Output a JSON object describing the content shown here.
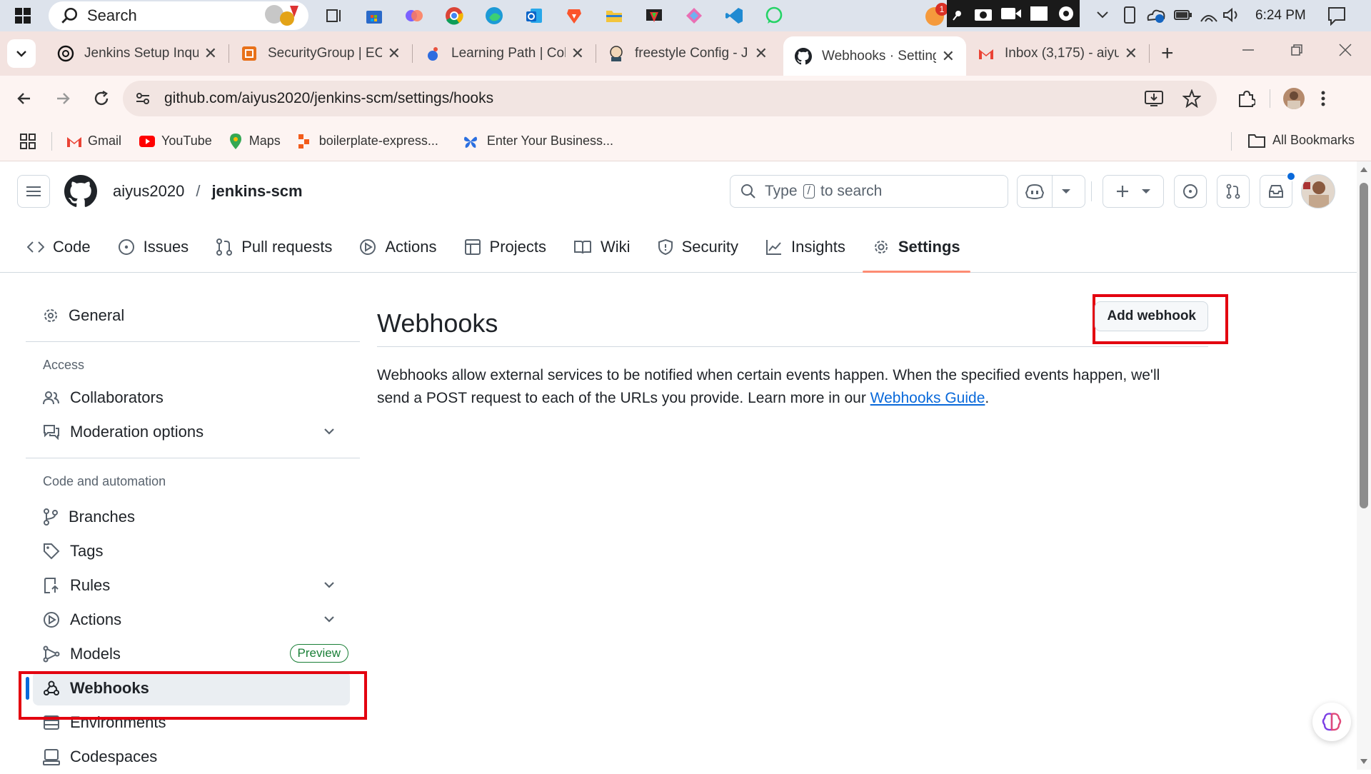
{
  "taskbar": {
    "search_placeholder": "Search",
    "time": "6:24 PM",
    "notification_count": "1"
  },
  "tabs": [
    {
      "label": "Jenkins Setup Inqu",
      "icon": "openai-icon"
    },
    {
      "label": "SecurityGroup | EC",
      "icon": "aws-icon"
    },
    {
      "label": "Learning Path | Col",
      "icon": "learning-icon"
    },
    {
      "label": "freestyle Config - J",
      "icon": "jenkins-icon"
    },
    {
      "label": "Webhooks · Setting",
      "icon": "github-icon",
      "active": true
    },
    {
      "label": "Inbox (3,175) - aiyu",
      "icon": "gmail-icon"
    }
  ],
  "address": {
    "url": "github.com/aiyus2020/jenkins-scm/settings/hooks"
  },
  "bookmarks": {
    "items": [
      "Gmail",
      "YouTube",
      "Maps",
      "boilerplate-express...",
      "Enter Your Business..."
    ],
    "all": "All Bookmarks"
  },
  "header": {
    "owner": "aiyus2020",
    "slash": "/",
    "repo": "jenkins-scm",
    "search_prefix": "Type",
    "search_key": "/",
    "search_suffix": "to search"
  },
  "repo_nav": [
    {
      "label": "Code",
      "icon": "code-icon"
    },
    {
      "label": "Issues",
      "icon": "issue-icon"
    },
    {
      "label": "Pull requests",
      "icon": "pull-request-icon"
    },
    {
      "label": "Actions",
      "icon": "play-icon"
    },
    {
      "label": "Projects",
      "icon": "table-icon"
    },
    {
      "label": "Wiki",
      "icon": "book-icon"
    },
    {
      "label": "Security",
      "icon": "shield-icon"
    },
    {
      "label": "Insights",
      "icon": "graph-icon"
    },
    {
      "label": "Settings",
      "icon": "gear-icon",
      "active": true
    }
  ],
  "sidebar": {
    "general": "General",
    "access_heading": "Access",
    "collaborators": "Collaborators",
    "moderation": "Moderation options",
    "code_heading": "Code and automation",
    "branches": "Branches",
    "tags": "Tags",
    "rules": "Rules",
    "actions": "Actions",
    "models": "Models",
    "preview_badge": "Preview",
    "webhooks": "Webhooks",
    "environments": "Environments",
    "codespaces": "Codespaces"
  },
  "main": {
    "title": "Webhooks",
    "add_button": "Add webhook",
    "description": "Webhooks allow external services to be notified when certain events happen. When the specified events happen, we'll send a POST request to each of the URLs you provide. Learn more in our",
    "link": "Webhooks Guide",
    "period": "."
  },
  "colors": {
    "highlight_box": "#e3000f",
    "active_tab_underline": "#fd8c73",
    "link": "#0969da",
    "preview_badge": "#1a7f37"
  }
}
